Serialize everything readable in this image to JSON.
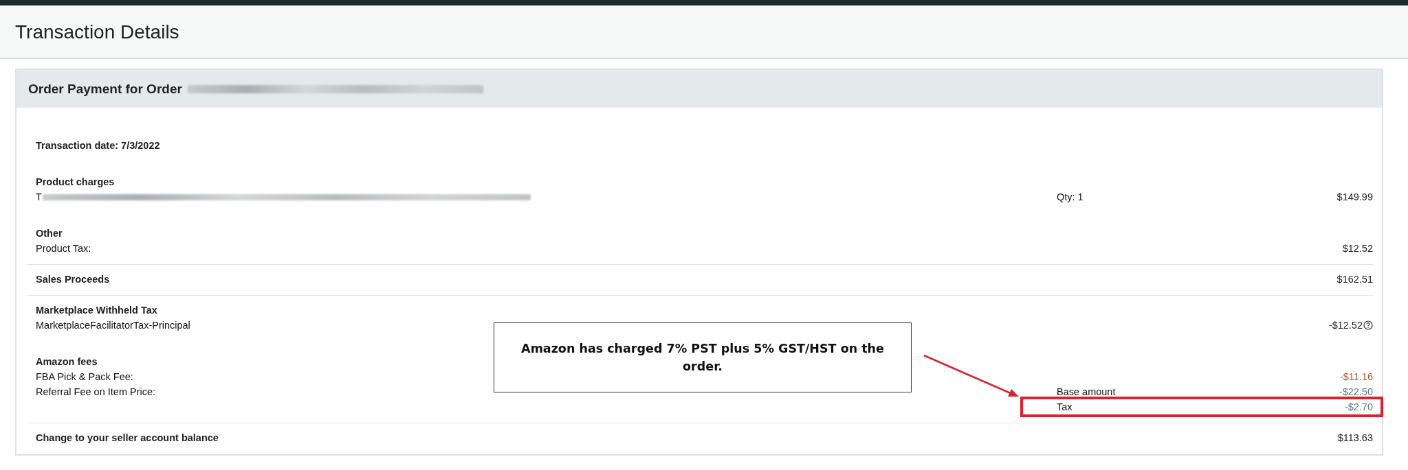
{
  "page_title": "Transaction Details",
  "panel": {
    "title": "Order Payment for Order",
    "order_number_blurred": true,
    "sections": [
      {
        "title": "Transaction date: 7/3/2022",
        "divider": false
      },
      {
        "title": "Product charges",
        "divider": false,
        "lines": [
          {
            "label": "T",
            "blurred": true,
            "detail": "Qty: 1",
            "amount": "$149.99",
            "color": "#222222"
          }
        ]
      },
      {
        "title": "Other",
        "divider": true,
        "lines": [
          {
            "label": "Product Tax:",
            "amount": "$12.52",
            "color": "#222222"
          }
        ]
      },
      {
        "title": "Sales Proceeds",
        "amount": "$162.51",
        "divider": true
      },
      {
        "title": "Marketplace Withheld Tax",
        "divider": false,
        "lines": [
          {
            "label": "MarketplaceFacilitatorTax-Principal",
            "amount": "-$12.52",
            "color": "#222222",
            "help": true
          }
        ]
      },
      {
        "title": "Amazon fees",
        "divider": true,
        "lines": [
          {
            "label": "FBA Pick & Pack Fee:",
            "amount": "-$11.16",
            "color": "#b5532f"
          },
          {
            "label": "Referral Fee on Item Price:",
            "detail": "Base amount",
            "amount": "-$22.50",
            "color": "#5d7a8c"
          },
          {
            "detail": "Tax",
            "amount": "-$2.70",
            "color": "#5d7a8c"
          }
        ]
      },
      {
        "title": "Change to your seller account balance",
        "amount": "$113.63",
        "divider": false
      }
    ]
  },
  "annotation": {
    "text": "Amazon has charged 7% PST plus 5% GST/HST on the order."
  }
}
